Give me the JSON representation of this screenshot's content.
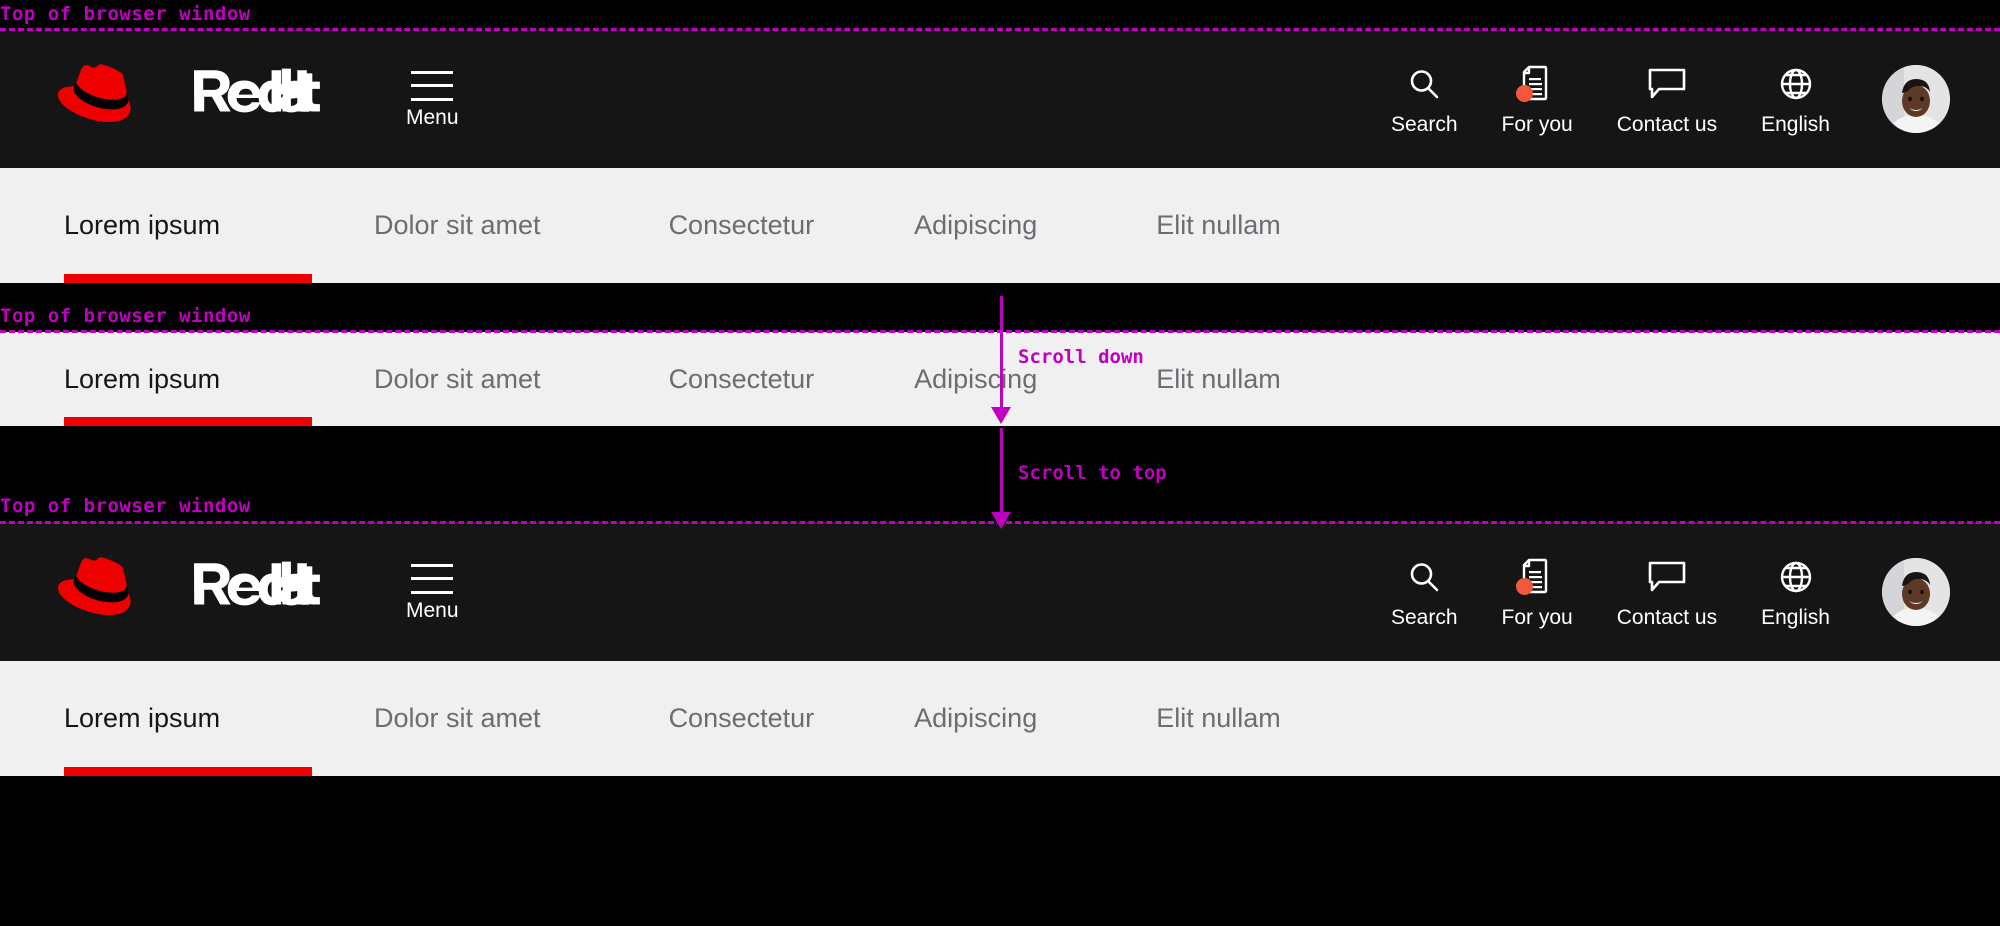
{
  "annotations": {
    "top_of_window_1": "Top of browser window",
    "top_of_window_2": "Top of browser window",
    "top_of_window_3": "Top of browser window",
    "scroll_down": "Scroll down",
    "scroll_to_top": "Scroll to top",
    "color": "#c000c0"
  },
  "masthead": {
    "logo_alt": "Red Hat",
    "logo_wordmark": "Red Hat",
    "menu_label": "Menu",
    "utilities": [
      {
        "label": "Search",
        "icon": "search-icon",
        "badge": false
      },
      {
        "label": "For you",
        "icon": "document-icon",
        "badge": true
      },
      {
        "label": "Contact us",
        "icon": "speech-bubble-icon",
        "badge": false
      },
      {
        "label": "English",
        "icon": "globe-icon",
        "badge": false
      }
    ],
    "avatar_label": "User profile",
    "background": "#151515",
    "badge_color": "#f4583c"
  },
  "tabbar": {
    "background": "#f0f0f0",
    "active_underline_color": "#ee0000",
    "active_index": 0,
    "tabs": [
      {
        "label": "Lorem ipsum",
        "active": true
      },
      {
        "label": "Dolor sit amet",
        "active": false
      },
      {
        "label": "Consectetur",
        "active": false
      },
      {
        "label": "Adipiscing",
        "active": false
      },
      {
        "label": "Elit nullam",
        "active": false
      }
    ]
  }
}
